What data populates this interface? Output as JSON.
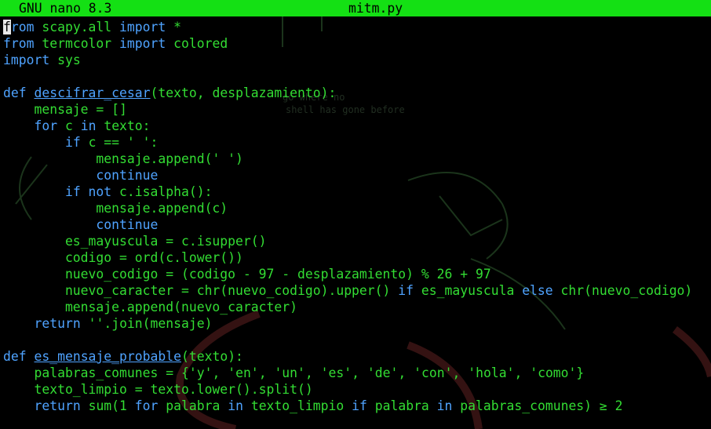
{
  "titlebar": {
    "app_version": "GNU nano 8.3",
    "filename": "mitm.py"
  },
  "colors": {
    "titlebar_bg": "#14e014",
    "keyword": "#4fa3ff",
    "identifier": "#33dd33",
    "background": "#000000"
  },
  "code_lines": [
    [
      {
        "t": "f",
        "c": "cursor"
      },
      {
        "t": "rom",
        "c": "kw"
      },
      {
        "t": " scapy.all ",
        "c": "g"
      },
      {
        "t": "import",
        "c": "kw"
      },
      {
        "t": " *",
        "c": "g"
      }
    ],
    [
      {
        "t": "from",
        "c": "kw"
      },
      {
        "t": " termcolor ",
        "c": "g"
      },
      {
        "t": "import",
        "c": "kw"
      },
      {
        "t": " colored",
        "c": "g"
      }
    ],
    [
      {
        "t": "import",
        "c": "kw"
      },
      {
        "t": " sys",
        "c": "g"
      }
    ],
    [],
    [
      {
        "t": "def",
        "c": "kw"
      },
      {
        "t": " ",
        "c": "g"
      },
      {
        "t": "descifrar_cesar",
        "c": "fn"
      },
      {
        "t": "(texto, desplazamiento):",
        "c": "g"
      }
    ],
    [
      {
        "t": "    mensaje = []",
        "c": "g"
      }
    ],
    [
      {
        "t": "    ",
        "c": "g"
      },
      {
        "t": "for",
        "c": "kw"
      },
      {
        "t": " c ",
        "c": "g"
      },
      {
        "t": "in",
        "c": "kw"
      },
      {
        "t": " texto:",
        "c": "g"
      }
    ],
    [
      {
        "t": "        ",
        "c": "g"
      },
      {
        "t": "if",
        "c": "kw"
      },
      {
        "t": " c == ",
        "c": "g"
      },
      {
        "t": "' '",
        "c": "s"
      },
      {
        "t": ":",
        "c": "g"
      }
    ],
    [
      {
        "t": "            mensaje.append(",
        "c": "g"
      },
      {
        "t": "' '",
        "c": "s"
      },
      {
        "t": ")",
        "c": "g"
      }
    ],
    [
      {
        "t": "            ",
        "c": "g"
      },
      {
        "t": "continue",
        "c": "kw"
      }
    ],
    [
      {
        "t": "        ",
        "c": "g"
      },
      {
        "t": "if not",
        "c": "kw"
      },
      {
        "t": " c.isalpha():",
        "c": "g"
      }
    ],
    [
      {
        "t": "            mensaje.append(c)",
        "c": "g"
      }
    ],
    [
      {
        "t": "            ",
        "c": "g"
      },
      {
        "t": "continue",
        "c": "kw"
      }
    ],
    [
      {
        "t": "        es_mayuscula = c.isupper()",
        "c": "g"
      }
    ],
    [
      {
        "t": "        codigo = ord(c.lower())",
        "c": "g"
      }
    ],
    [
      {
        "t": "        nuevo_codigo = (codigo - 97 - desplazamiento) % 26 + 97",
        "c": "g"
      }
    ],
    [
      {
        "t": "        nuevo_caracter = chr(nuevo_codigo).upper() ",
        "c": "g"
      },
      {
        "t": "if",
        "c": "kw"
      },
      {
        "t": " es_mayuscula ",
        "c": "g"
      },
      {
        "t": "else",
        "c": "kw"
      },
      {
        "t": " chr(nuevo_codigo)",
        "c": "g"
      }
    ],
    [
      {
        "t": "        mensaje.append(nuevo_caracter)",
        "c": "g"
      }
    ],
    [
      {
        "t": "    ",
        "c": "g"
      },
      {
        "t": "return",
        "c": "kw"
      },
      {
        "t": " ",
        "c": "g"
      },
      {
        "t": "''",
        "c": "s"
      },
      {
        "t": ".join(mensaje)",
        "c": "g"
      }
    ],
    [],
    [
      {
        "t": "def",
        "c": "kw"
      },
      {
        "t": " ",
        "c": "g"
      },
      {
        "t": "es_mensaje_probable",
        "c": "fn"
      },
      {
        "t": "(texto):",
        "c": "g"
      }
    ],
    [
      {
        "t": "    palabras_comunes = {",
        "c": "g"
      },
      {
        "t": "'y'",
        "c": "s"
      },
      {
        "t": ", ",
        "c": "g"
      },
      {
        "t": "'en'",
        "c": "s"
      },
      {
        "t": ", ",
        "c": "g"
      },
      {
        "t": "'un'",
        "c": "s"
      },
      {
        "t": ", ",
        "c": "g"
      },
      {
        "t": "'es'",
        "c": "s"
      },
      {
        "t": ", ",
        "c": "g"
      },
      {
        "t": "'de'",
        "c": "s"
      },
      {
        "t": ", ",
        "c": "g"
      },
      {
        "t": "'con'",
        "c": "s"
      },
      {
        "t": ", ",
        "c": "g"
      },
      {
        "t": "'hola'",
        "c": "s"
      },
      {
        "t": ", ",
        "c": "g"
      },
      {
        "t": "'como'",
        "c": "s"
      },
      {
        "t": "}",
        "c": "g"
      }
    ],
    [
      {
        "t": "    texto_limpio = texto.lower().split()",
        "c": "g"
      }
    ],
    [
      {
        "t": "    ",
        "c": "g"
      },
      {
        "t": "return",
        "c": "kw"
      },
      {
        "t": " sum(1 ",
        "c": "g"
      },
      {
        "t": "for",
        "c": "kw"
      },
      {
        "t": " palabra ",
        "c": "g"
      },
      {
        "t": "in",
        "c": "kw"
      },
      {
        "t": " texto_limpio ",
        "c": "g"
      },
      {
        "t": "if",
        "c": "kw"
      },
      {
        "t": " palabra ",
        "c": "g"
      },
      {
        "t": "in",
        "c": "kw"
      },
      {
        "t": " palabras_comunes) ≥ 2",
        "c": "g"
      }
    ]
  ]
}
